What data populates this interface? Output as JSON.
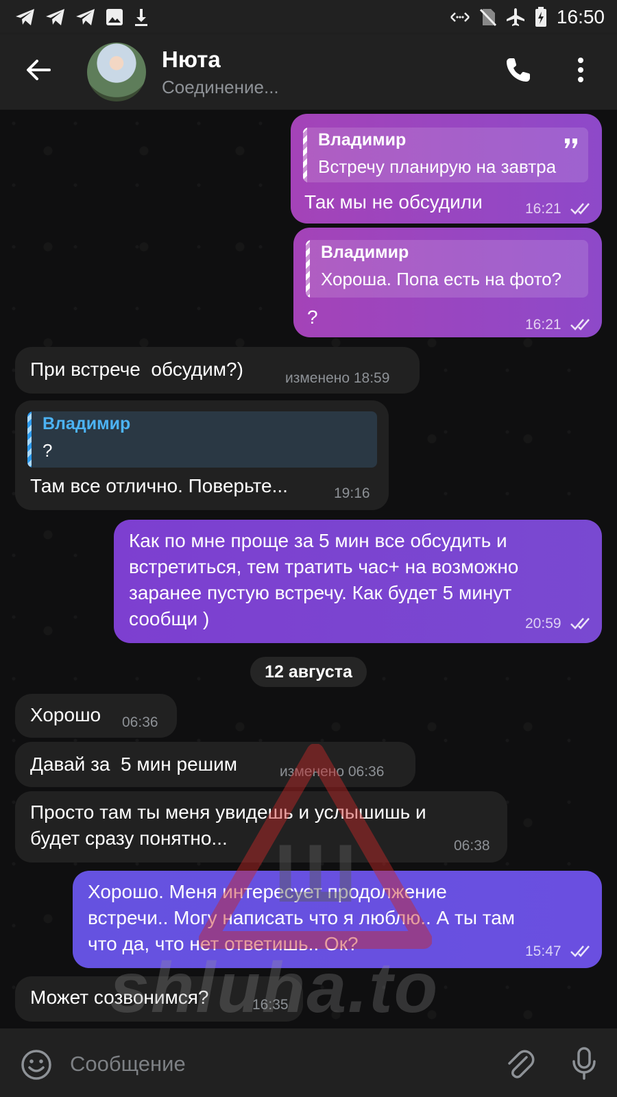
{
  "status_bar": {
    "time": "16:50",
    "left_icons": [
      "telegram-icon",
      "telegram-icon",
      "telegram-icon",
      "image-icon",
      "download-icon"
    ],
    "right_icons": [
      "data-saver-icon",
      "no-sim-icon",
      "airplane-icon",
      "battery-charging-icon"
    ]
  },
  "header": {
    "name": "Нюта",
    "status": "Соединение..."
  },
  "messages": [
    {
      "type": "out",
      "reply": {
        "author": "Владимир",
        "text": "Встречу планирую на завтра"
      },
      "text": "Так мы не обсудили",
      "time": "16:21"
    },
    {
      "type": "out",
      "reply": {
        "author": "Владимир",
        "text": "Хороша. Попа есть на фото?"
      },
      "text": "?",
      "time": "16:21"
    },
    {
      "type": "in",
      "text": "При встрече  обсудим?)",
      "time": "изменено 18:59"
    },
    {
      "type": "in",
      "reply": {
        "author": "Владимир",
        "text": "?"
      },
      "text": "Там все отлично. Поверьте...",
      "time": "19:16"
    },
    {
      "type": "out",
      "text": "Как по мне проще за 5 мин все обсудить и\nвстретиться, тем тратить час+ на возможно\nзаранее пустую встречу. Как будет 5 минут\nсообщи )",
      "time": "20:59"
    },
    {
      "type": "in",
      "text": "Хорошо",
      "time": "06:36"
    },
    {
      "type": "in",
      "text": "Давай за  5 мин решим",
      "time": "изменено 06:36"
    },
    {
      "type": "in",
      "text": "Просто там ты меня увидешь и услышишь и\nбудет сразу понятно...",
      "time": "06:38"
    },
    {
      "type": "out",
      "text": "Хорошо. Меня интересует продолжение\nвстречи.. Могу написать что я люблю.. А ты там\nчто да, что нет ответишь.. Ок?",
      "time": "15:47"
    },
    {
      "type": "in",
      "text": "Может созвонимся?",
      "time": "16:35"
    }
  ],
  "date_separator": "12 августа",
  "watermark": "shluha.to",
  "watermark_sign": "Ш",
  "composer": {
    "placeholder": "Сообщение"
  },
  "colors": {
    "header_bg": "#212121",
    "incoming_bubble": "#212121",
    "outgoing_gradient_start": "#a443b8",
    "outgoing_gradient_end": "#6552e0",
    "reply_name_incoming": "#4cb3f4"
  }
}
